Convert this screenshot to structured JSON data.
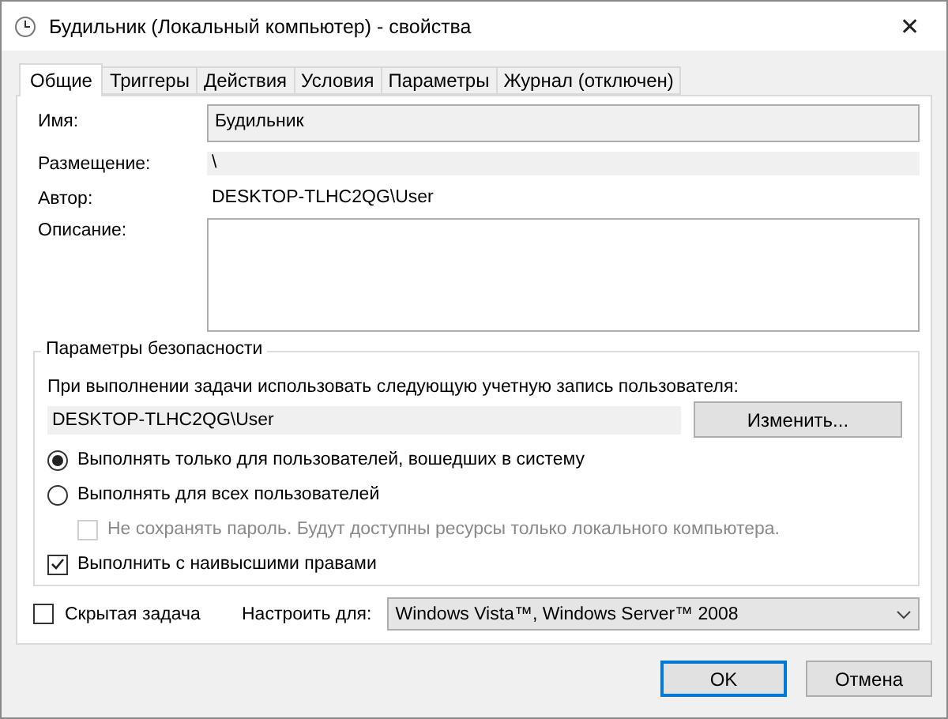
{
  "window": {
    "title": "Будильник (Локальный компьютер) - свойства",
    "close": "✕"
  },
  "tabs": [
    {
      "label": "Общие",
      "selected": true
    },
    {
      "label": "Триггеры",
      "selected": false
    },
    {
      "label": "Действия",
      "selected": false
    },
    {
      "label": "Условия",
      "selected": false
    },
    {
      "label": "Параметры",
      "selected": false
    },
    {
      "label": "Журнал (отключен)",
      "selected": false
    }
  ],
  "fields": [
    {
      "kind": "input",
      "label": "Имя:",
      "value": "Будильник"
    },
    {
      "kind": "readonly",
      "label": "Размещение:",
      "value": "\\"
    },
    {
      "kind": "text",
      "label": "Автор:",
      "value": "DESKTOP-TLHC2QG\\User"
    },
    {
      "kind": "textarea",
      "label": "Описание:"
    }
  ],
  "security": {
    "legend": "Параметры безопасности",
    "prompt": "При выполнении задачи использовать следующую учетную запись пользователя:",
    "account": "DESKTOP-TLHC2QG\\User",
    "change_button": "Изменить...",
    "options": [
      {
        "kind": "radio",
        "label": "Выполнять только для пользователей, вошедших в систему",
        "selected": true,
        "disabled": false,
        "indented": false
      },
      {
        "kind": "radio",
        "label": "Выполнять для всех пользователей",
        "selected": false,
        "disabled": false,
        "indented": false
      },
      {
        "kind": "checkbox",
        "label": "Не сохранять пароль. Будут доступны ресурсы только локального компьютера.",
        "checked": false,
        "disabled": true,
        "indented": true
      },
      {
        "kind": "checkbox",
        "label": "Выполнить с наивысшими правами",
        "checked": true,
        "disabled": false,
        "indented": false
      }
    ]
  },
  "hidden_task": {
    "label": "Скрытая задача",
    "checked": false
  },
  "configure": {
    "label": "Настроить для:",
    "value": "Windows Vista™, Windows Server™ 2008"
  },
  "buttons": [
    {
      "label": "OK",
      "default": true
    },
    {
      "label": "Отмена",
      "default": false
    }
  ]
}
